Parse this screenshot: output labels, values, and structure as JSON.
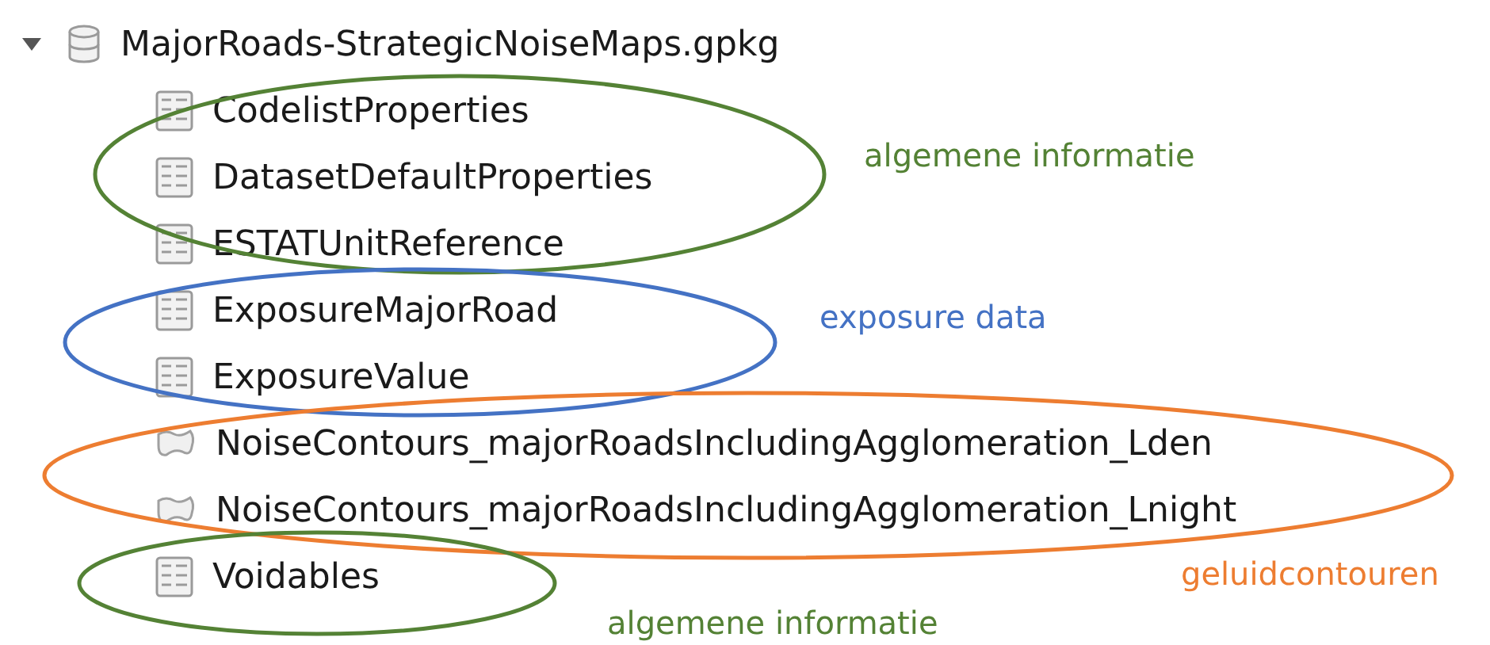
{
  "tree": {
    "label": "MajorRoads-StrategicNoiseMaps.gpkg",
    "expanded": true,
    "children": [
      {
        "label": "CodelistProperties",
        "kind": "table"
      },
      {
        "label": "DatasetDefaultProperties",
        "kind": "table"
      },
      {
        "label": "ESTATUnitReference",
        "kind": "table"
      },
      {
        "label": "ExposureMajorRoad",
        "kind": "table"
      },
      {
        "label": "ExposureValue",
        "kind": "table"
      },
      {
        "label": "NoiseContours_majorRoadsIncludingAgglomeration_Lden",
        "kind": "polygon"
      },
      {
        "label": "NoiseContours_majorRoadsIncludingAgglomeration_Lnight",
        "kind": "polygon"
      },
      {
        "label": "Voidables",
        "kind": "table"
      }
    ]
  },
  "annotations": [
    {
      "label": "algemene informatie",
      "color": "#548235"
    },
    {
      "label": "exposure data",
      "color": "#4472c4"
    },
    {
      "label": "geluidcontouren",
      "color": "#ed7d31"
    },
    {
      "label": "algemene informatie",
      "color": "#548235"
    }
  ]
}
